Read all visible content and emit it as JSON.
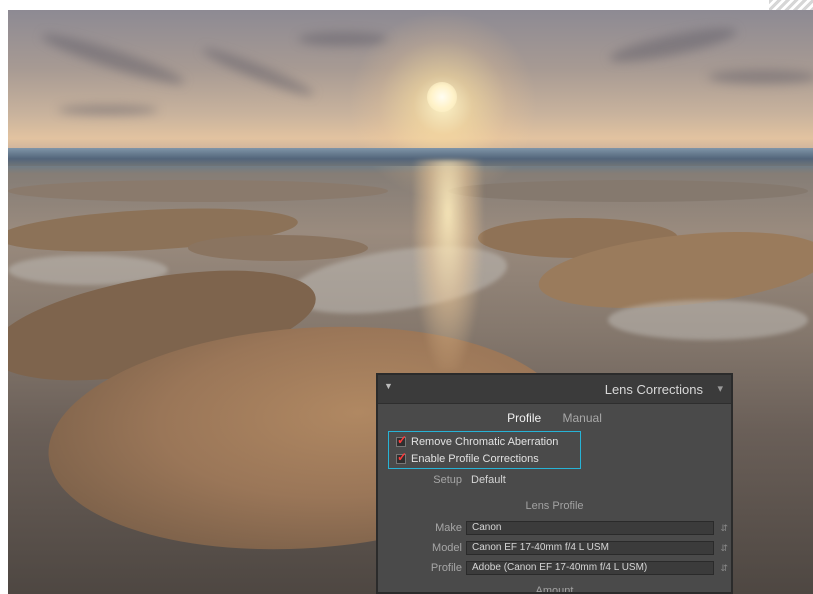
{
  "panel": {
    "title": "Lens Corrections",
    "tabs": [
      {
        "label": "Profile",
        "active": true
      },
      {
        "label": "Manual",
        "active": false
      }
    ],
    "checkboxes": [
      {
        "label": "Remove Chromatic Aberration",
        "checked": true
      },
      {
        "label": "Enable Profile Corrections",
        "checked": true
      }
    ],
    "setup": {
      "label": "Setup",
      "value": "Default"
    },
    "lens_profile": {
      "section_title": "Lens Profile",
      "fields": [
        {
          "label": "Make",
          "value": "Canon"
        },
        {
          "label": "Model",
          "value": "Canon EF 17-40mm f/4 L USM"
        },
        {
          "label": "Profile",
          "value": "Adobe (Canon EF 17-40mm f/4 L USM)"
        }
      ]
    },
    "amount_title": "Amount"
  },
  "icons": {
    "collapse": "triangle-down-icon",
    "menu": "panel-menu-icon",
    "dropdown": "updown-arrows-icon"
  },
  "colors": {
    "highlight_border": "#27b3d6",
    "checkmark": "#ff3a3a",
    "panel_bg": "#4a4a4a"
  }
}
